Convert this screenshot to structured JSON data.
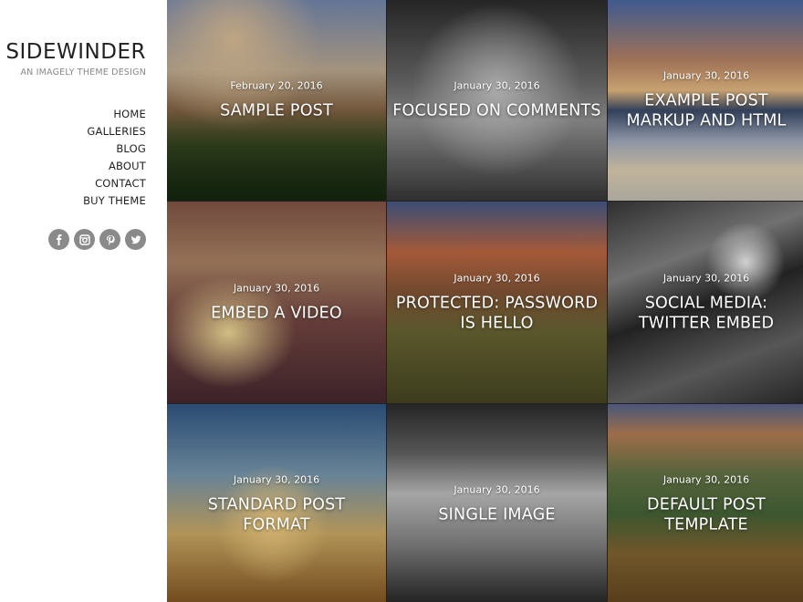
{
  "site": {
    "title": "SIDEWINDER",
    "tagline": "AN IMAGELY THEME DESIGN"
  },
  "nav": {
    "items": [
      {
        "label": "HOME"
      },
      {
        "label": "GALLERIES"
      },
      {
        "label": "BLOG"
      },
      {
        "label": "ABOUT"
      },
      {
        "label": "CONTACT"
      },
      {
        "label": "BUY THEME"
      }
    ]
  },
  "social": {
    "icons": [
      "facebook-icon",
      "instagram-icon",
      "pinterest-icon",
      "twitter-icon"
    ],
    "color": "#8a8a8a"
  },
  "posts": [
    {
      "date": "February 20, 2016",
      "title": "SAMPLE POST"
    },
    {
      "date": "January 30, 2016",
      "title": "FOCUSED ON COMMENTS"
    },
    {
      "date": "January 30, 2016",
      "title": "EXAMPLE POST MARKUP AND HTML"
    },
    {
      "date": "January 30, 2016",
      "title": "EMBED A VIDEO"
    },
    {
      "date": "January 30, 2016",
      "title": "PROTECTED: PASSWORD IS HELLO"
    },
    {
      "date": "January 30, 2016",
      "title": "SOCIAL MEDIA: TWITTER EMBED"
    },
    {
      "date": "January 30, 2016",
      "title": "STANDARD POST FORMAT"
    },
    {
      "date": "January 30, 2016",
      "title": "SINGLE IMAGE"
    },
    {
      "date": "January 30, 2016",
      "title": "DEFAULT POST TEMPLATE"
    }
  ]
}
